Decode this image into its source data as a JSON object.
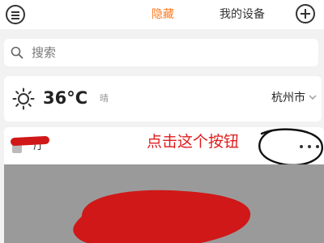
{
  "header": {
    "tabs": [
      {
        "label": "隐藏",
        "active": true
      },
      {
        "label": "我的设备",
        "active": false
      }
    ],
    "menu_icon": "menu-icon",
    "add_icon": "plus-circle-icon"
  },
  "search": {
    "placeholder": "搜索",
    "icon": "search-icon"
  },
  "weather": {
    "icon": "sun-icon",
    "temperature": "36°C",
    "condition": "晴",
    "city": "杭州市",
    "city_icon": "chevron-down-icon"
  },
  "room": {
    "name_partial": "厅",
    "more_icon": "more-dots-icon",
    "annotation": "点击这个按钮"
  },
  "colors": {
    "accent": "#ff7a1f",
    "annotation_red": "#e01b1b",
    "background": "#f2f2f2"
  }
}
